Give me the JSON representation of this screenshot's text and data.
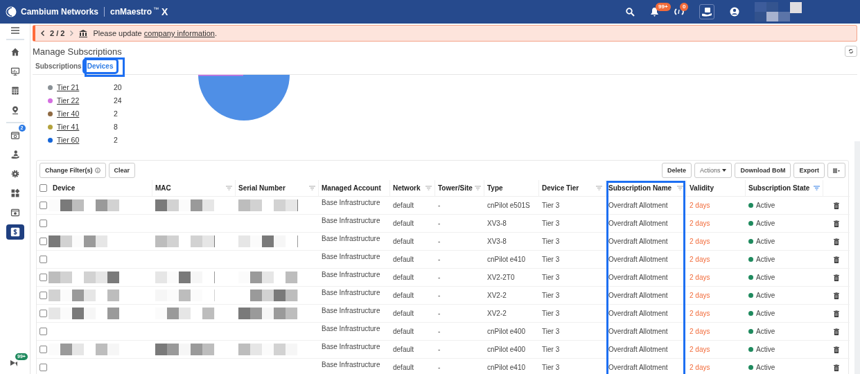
{
  "topbar": {
    "brand": "Cambium Networks",
    "product": "cnMaestro",
    "trademark": "™",
    "edition": "X",
    "alerts_badge": "99+",
    "sync_badge": "0"
  },
  "sidebar": {
    "items": [
      {
        "selected": false
      },
      {
        "selected": false
      },
      {
        "selected": false
      },
      {
        "selected": false
      },
      {
        "selected": false,
        "badge": "2"
      },
      {
        "selected": false
      },
      {
        "selected": false
      },
      {
        "selected": false
      },
      {
        "selected": false
      },
      {
        "selected": true
      }
    ],
    "footer_badge": "99+"
  },
  "banner": {
    "pager": "2 / 2",
    "text": "Please update ",
    "link": "company information",
    "end": "."
  },
  "page_title": "Manage Subscriptions",
  "tabs": [
    {
      "label": "Subscriptions",
      "selected": false
    },
    {
      "label": "Devices",
      "selected": true
    }
  ],
  "legend": [
    {
      "label": "Tier 21",
      "count": "20",
      "color": "#8a9196"
    },
    {
      "label": "Tier 22",
      "count": "24",
      "color": "#d46ee0"
    },
    {
      "label": "Tier 40",
      "count": "2",
      "color": "#8f6a43"
    },
    {
      "label": "Tier 41",
      "count": "8",
      "color": "#b3a23c"
    },
    {
      "label": "Tier 60",
      "count": "2",
      "color": "#1565d8"
    }
  ],
  "toolbar": {
    "left": [
      "Change Filter(s)",
      "Clear"
    ],
    "right": [
      "Delete",
      "Actions",
      "Download BoM",
      "Export"
    ]
  },
  "table": {
    "select_all_checked": false,
    "columns": [
      {
        "label": "Device",
        "filterable": false
      },
      {
        "label": "MAC",
        "filterable": true,
        "filtered": false
      },
      {
        "label": "Serial Number",
        "filterable": true,
        "filtered": false
      },
      {
        "label": "Managed Account",
        "filterable": false
      },
      {
        "label": "Network",
        "filterable": true,
        "filtered": false
      },
      {
        "label": "Tower/Site",
        "filterable": true,
        "filtered": false
      },
      {
        "label": "Type",
        "filterable": false
      },
      {
        "label": "Device Tier",
        "filterable": true,
        "filtered": false
      },
      {
        "label": "Subscription Name",
        "filterable": true,
        "filtered": false
      },
      {
        "label": "Validity",
        "filterable": false
      },
      {
        "label": "Subscription State",
        "filterable": true,
        "filtered": true
      }
    ],
    "rows": [
      {
        "checked": false,
        "account": "Base Infrastructure",
        "network": "default",
        "site": "-",
        "type": "cnPilot e501S",
        "tier": "Tier 3",
        "subscription": "Overdraft Allotment",
        "validity": "2 days",
        "state": "Active"
      },
      {
        "checked": false,
        "account": "Base Infrastructure",
        "network": "default",
        "site": "-",
        "type": "XV3-8",
        "tier": "Tier 3",
        "subscription": "Overdraft Allotment",
        "validity": "2 days",
        "state": "Active"
      },
      {
        "checked": false,
        "account": "Base Infrastructure",
        "network": "default",
        "site": "-",
        "type": "XV3-8",
        "tier": "Tier 3",
        "subscription": "Overdraft Allotment",
        "validity": "2 days",
        "state": "Active"
      },
      {
        "checked": false,
        "account": "Base Infrastructure",
        "network": "default",
        "site": "-",
        "type": "cnPilot e410",
        "tier": "Tier 3",
        "subscription": "Overdraft Allotment",
        "validity": "2 days",
        "state": "Active"
      },
      {
        "checked": false,
        "account": "Base Infrastructure",
        "network": "default",
        "site": "-",
        "type": "XV2-2T0",
        "tier": "Tier 3",
        "subscription": "Overdraft Allotment",
        "validity": "2 days",
        "state": "Active"
      },
      {
        "checked": false,
        "account": "Base Infrastructure",
        "network": "default",
        "site": "-",
        "type": "XV2-2",
        "tier": "Tier 3",
        "subscription": "Overdraft Allotment",
        "validity": "2 days",
        "state": "Active"
      },
      {
        "checked": false,
        "account": "Base Infrastructure",
        "network": "default",
        "site": "-",
        "type": "XV2-2",
        "tier": "Tier 3",
        "subscription": "Overdraft Allotment",
        "validity": "2 days",
        "state": "Active"
      },
      {
        "checked": false,
        "account": "Base Infrastructure",
        "network": "default",
        "site": "-",
        "type": "cnPilot e400",
        "tier": "Tier 3",
        "subscription": "Overdraft Allotment",
        "validity": "2 days",
        "state": "Active"
      },
      {
        "checked": false,
        "account": "Base Infrastructure",
        "network": "default",
        "site": "-",
        "type": "cnPilot e400",
        "tier": "Tier 3",
        "subscription": "Overdraft Allotment",
        "validity": "2 days",
        "state": "Active"
      },
      {
        "checked": false,
        "account": "Base Infrastructure",
        "network": "default",
        "site": "-",
        "type": "cnPilot e410",
        "tier": "Tier 3",
        "subscription": "Overdraft Allotment",
        "validity": "2 days",
        "state": "Active"
      }
    ]
  }
}
